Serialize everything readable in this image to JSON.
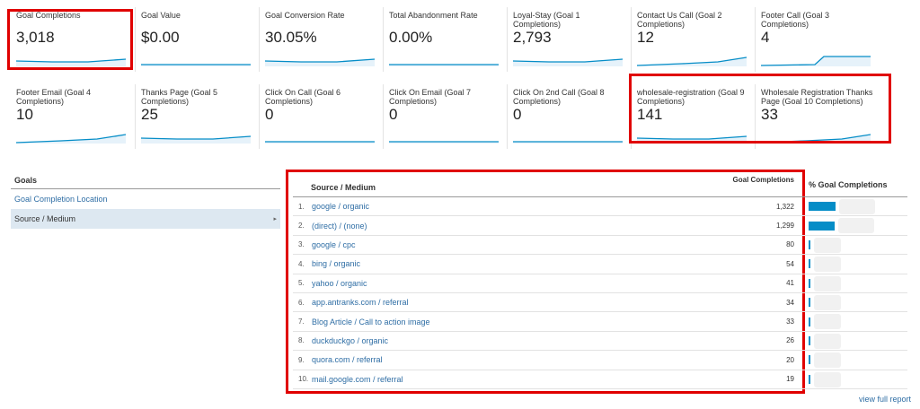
{
  "metrics_row1": [
    {
      "label": "Goal Completions",
      "value": "3,018"
    },
    {
      "label": "Goal Value",
      "value": "$0.00"
    },
    {
      "label": "Goal Conversion Rate",
      "value": "30.05%"
    },
    {
      "label": "Total Abandonment Rate",
      "value": "0.00%"
    },
    {
      "label": "Loyal-Stay (Goal 1 Completions)",
      "value": "2,793"
    },
    {
      "label": "Contact Us Call (Goal 2 Completions)",
      "value": "12"
    },
    {
      "label": "Footer Call (Goal 3 Completions)",
      "value": "4"
    }
  ],
  "metrics_row2": [
    {
      "label": "Footer Email (Goal 4 Completions)",
      "value": "10"
    },
    {
      "label": "Thanks Page (Goal 5 Completions)",
      "value": "25"
    },
    {
      "label": "Click On Call (Goal 6 Completions)",
      "value": "0"
    },
    {
      "label": "Click On Email (Goal 7 Completions)",
      "value": "0"
    },
    {
      "label": "Click On 2nd Call (Goal 8 Completions)",
      "value": "0"
    },
    {
      "label": "wholesale-registration (Goal 9 Completions)",
      "value": "141"
    },
    {
      "label": "Wholesale Registration Thanks Page (Goal 10 Completions)",
      "value": "33"
    }
  ],
  "goals_nav": {
    "heading": "Goals",
    "items": [
      {
        "label": "Goal Completion Location"
      },
      {
        "label": "Source / Medium"
      }
    ],
    "active_chevron": "▸"
  },
  "table": {
    "col_source": "Source / Medium",
    "col_goal": "Goal Completions",
    "col_pct": "% Goal Completions",
    "rows": [
      {
        "num": "1.",
        "source": "google / organic",
        "goals": "1,322",
        "share": 0.438
      },
      {
        "num": "2.",
        "source": "(direct) / (none)",
        "goals": "1,299",
        "share": 0.43
      },
      {
        "num": "3.",
        "source": "google / cpc",
        "goals": "80",
        "share": 0.027
      },
      {
        "num": "4.",
        "source": "bing / organic",
        "goals": "54",
        "share": 0.018
      },
      {
        "num": "5.",
        "source": "yahoo / organic",
        "goals": "41",
        "share": 0.014
      },
      {
        "num": "6.",
        "source": "app.antranks.com / referral",
        "goals": "34",
        "share": 0.011
      },
      {
        "num": "7.",
        "source": "Blog Article / Call to action image",
        "goals": "33",
        "share": 0.011
      },
      {
        "num": "8.",
        "source": "duckduckgo / organic",
        "goals": "26",
        "share": 0.009
      },
      {
        "num": "9.",
        "source": "quora.com / referral",
        "goals": "20",
        "share": 0.007
      },
      {
        "num": "10.",
        "source": "mail.google.com / referral",
        "goals": "19",
        "share": 0.006
      }
    ]
  },
  "view_full_report": "view full report",
  "colors": {
    "accent": "#058dc7",
    "highlight": "#e00000",
    "link": "#2f6ea5"
  }
}
